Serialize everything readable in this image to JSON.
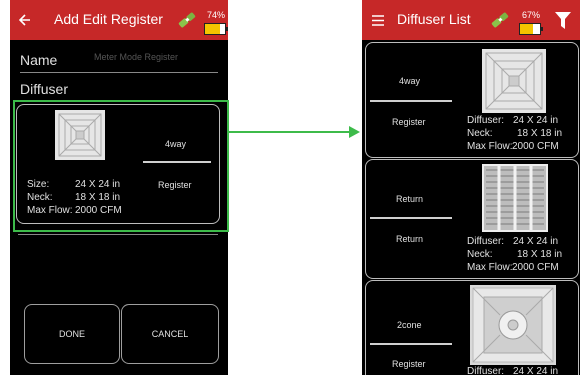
{
  "left": {
    "title": "Add Edit Register",
    "battery_pct": "74%",
    "name_label": "Name",
    "name_placeholder": "Meter Mode Register",
    "diffuser_label": "Diffuser",
    "item": {
      "type": "4way",
      "category": "Register",
      "size_label": "Size:",
      "size_value": "24 X 24 in",
      "neck_label": "Neck:",
      "neck_value": "18 X 18 in",
      "maxflow_label": "Max Flow:",
      "maxflow_value": "2000 CFM"
    },
    "done": "DONE",
    "cancel": "CANCEL"
  },
  "right": {
    "title": "Diffuser List",
    "battery_pct": "67%",
    "items": [
      {
        "type": "4way",
        "category": "Register",
        "diffuser": "24 X 24 in",
        "neck": "18 X 18 in",
        "maxflow": "2000 CFM"
      },
      {
        "type": "Return",
        "category": "Return",
        "diffuser": "24 X 24 in",
        "neck": "18 X 18 in",
        "maxflow": "2000 CFM"
      },
      {
        "type": "2cone",
        "category": "Register",
        "diffuser": "24 X 24 in"
      }
    ],
    "labels": {
      "diffuser": "Diffuser:",
      "neck": "Neck:",
      "maxflow": "Max Flow:"
    }
  },
  "colors": {
    "header": "#c62828",
    "highlight": "#3dbb4a",
    "battery": "#f5c400"
  }
}
